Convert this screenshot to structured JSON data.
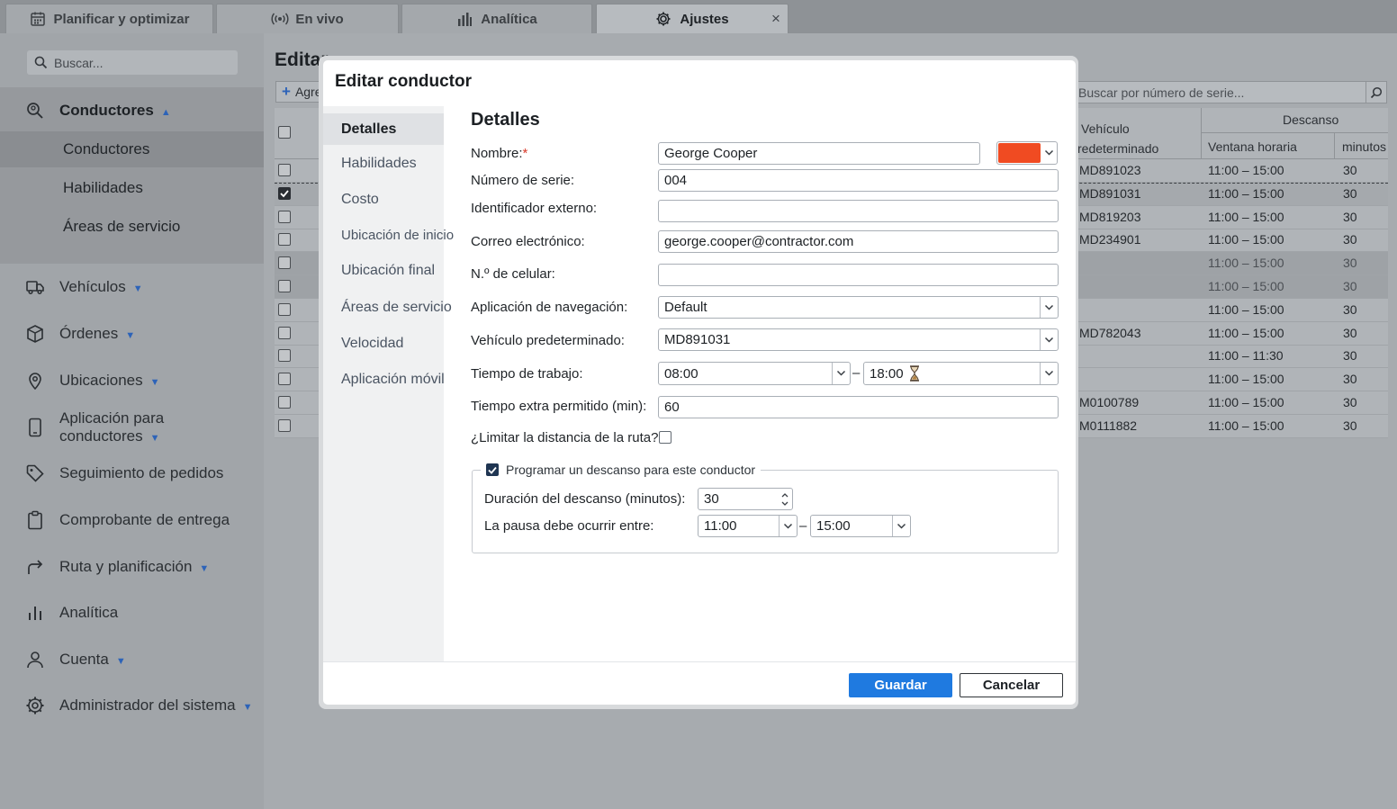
{
  "tabs": [
    {
      "label": "Planificar y optimizar",
      "icon": "calendar-icon"
    },
    {
      "label": "En vivo",
      "icon": "live-broadcast-icon"
    },
    {
      "label": "Analítica",
      "icon": "bar-chart-icon"
    },
    {
      "label": "Ajustes",
      "icon": "gear-icon",
      "active": true
    }
  ],
  "tab_close": "×",
  "sidebar": {
    "search_placeholder": "Buscar...",
    "section": {
      "label": "Conductores",
      "expanded": true
    },
    "sub_items": [
      "Conductores",
      "Habilidades",
      "Áreas de servicio"
    ],
    "items": [
      {
        "label": "Vehículos",
        "icon": "truck-icon"
      },
      {
        "label": "Órdenes",
        "icon": "box-icon"
      },
      {
        "label": "Ubicaciones",
        "icon": "map-pin-icon"
      },
      {
        "label": "Aplicación para conductores",
        "icon": "phone-icon"
      },
      {
        "label": "Seguimiento de pedidos",
        "icon": "tag-icon"
      },
      {
        "label": "Comprobante de entrega",
        "icon": "clipboard-icon"
      },
      {
        "label": "Ruta y planificación",
        "icon": "route-arrow-icon"
      },
      {
        "label": "Analítica",
        "icon": "bar-chart-icon"
      },
      {
        "label": "Cuenta",
        "icon": "user-icon"
      },
      {
        "label": "Administrador del sistema",
        "icon": "gear-icon"
      }
    ]
  },
  "page": {
    "title": "Editar",
    "add_button": "Agre",
    "serial_search_placeholder": "Buscar por número de serie...",
    "table": {
      "col_vehicle": "Vehículo",
      "col_vehicle_sub": "redeterminado",
      "col_break": "Descanso",
      "col_window": "Ventana horaria",
      "col_minutes": "minutos",
      "rows": [
        {
          "vehicle": "MD891023",
          "window": "11:00 – 15:00",
          "minutes": "30"
        },
        {
          "vehicle": "MD891031",
          "window": "11:00 – 15:00",
          "minutes": "30",
          "checked": true
        },
        {
          "vehicle": "MD819203",
          "window": "11:00 – 15:00",
          "minutes": "30"
        },
        {
          "vehicle": "MD234901",
          "window": "11:00 – 15:00",
          "minutes": "30"
        },
        {
          "vehicle": "",
          "window": "11:00 – 15:00",
          "minutes": "30",
          "dim": true
        },
        {
          "vehicle": "",
          "window": "11:00 – 15:00",
          "minutes": "30",
          "dim": true
        },
        {
          "vehicle": "",
          "window": "11:00 – 15:00",
          "minutes": "30"
        },
        {
          "vehicle": "MD782043",
          "window": "11:00 – 15:00",
          "minutes": "30"
        },
        {
          "vehicle": "",
          "window": "11:00 – 11:30",
          "minutes": "30"
        },
        {
          "vehicle": "",
          "window": "11:00 – 15:00",
          "minutes": "30"
        },
        {
          "vehicle": "M0100789",
          "window": "11:00 – 15:00",
          "minutes": "30"
        },
        {
          "vehicle": "M0111882",
          "window": "11:00 – 15:00",
          "minutes": "30"
        }
      ]
    }
  },
  "modal": {
    "title": "Editar conductor",
    "nav": [
      "Detalles",
      "Habilidades",
      "Costo",
      "Ubicación de inicio",
      "Ubicación final",
      "Áreas de servicio",
      "Velocidad",
      "Aplicación móvil"
    ],
    "section_title": "Detalles",
    "fields": {
      "name": {
        "label": "Nombre:",
        "required_mark": "*",
        "value": "George Cooper",
        "color": "#f04b22"
      },
      "serial": {
        "label": "Número de serie:",
        "value": "004"
      },
      "external_id": {
        "label": "Identificador externo:",
        "value": ""
      },
      "email": {
        "label": "Correo electrónico:",
        "value": "george.cooper@contractor.com"
      },
      "phone": {
        "label": "N.º de celular:",
        "value": ""
      },
      "nav_app": {
        "label": "Aplicación de navegación:",
        "value": "Default"
      },
      "default_vehicle": {
        "label": "Vehículo predeterminado:",
        "value": "MD891031"
      },
      "work_time": {
        "label": "Tiempo de trabajo:",
        "start": "08:00",
        "end": "18:00",
        "separator": "–"
      },
      "overtime": {
        "label": "Tiempo extra permitido (min):",
        "value": "60"
      },
      "limit_distance": {
        "label": "¿Limitar la distancia de la ruta?",
        "checked": false
      }
    },
    "break": {
      "legend": "Programar un descanso para este conductor",
      "enabled": true,
      "duration_label": "Duración del descanso (minutos):",
      "duration_value": "30",
      "between_label": "La pausa debe ocurrir entre:",
      "start": "11:00",
      "end": "15:00",
      "separator": "–"
    },
    "save_label": "Guardar",
    "cancel_label": "Cancelar"
  }
}
